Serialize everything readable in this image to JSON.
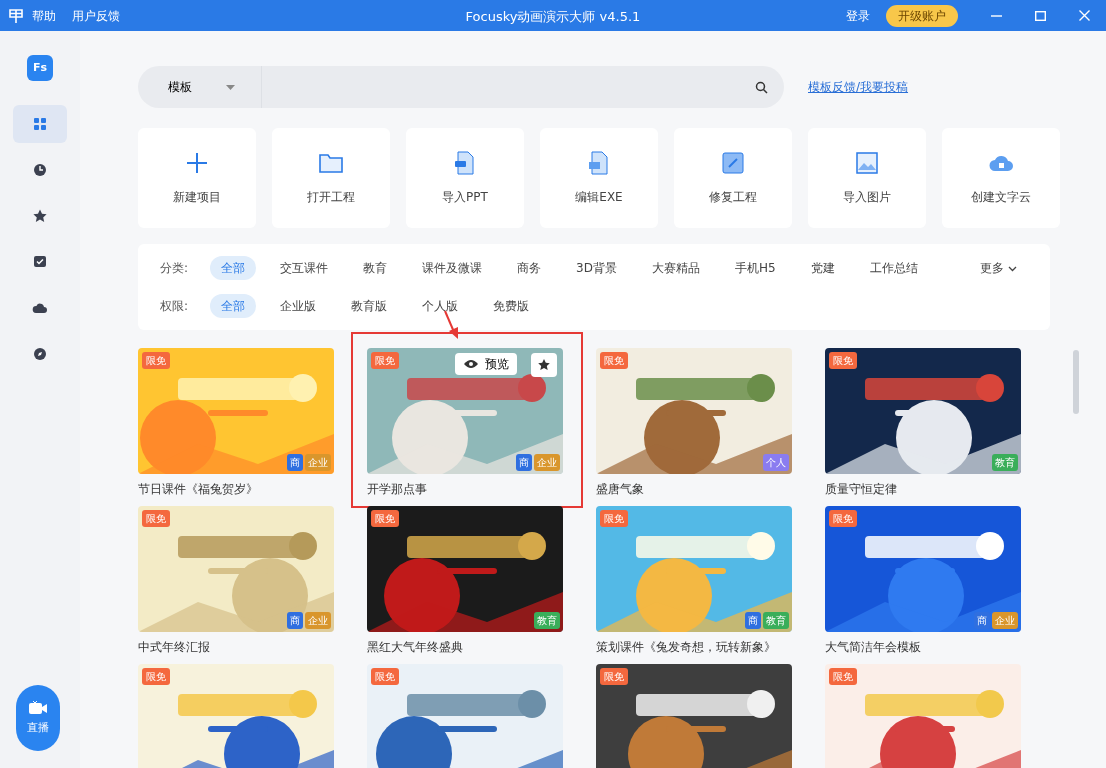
{
  "window": {
    "menu": [
      "帮助",
      "用户反馈"
    ],
    "title": "Focusky动画演示大师 v4.5.1",
    "login": "登录",
    "upgrade": "开级账户"
  },
  "sidebar": {
    "logo": "Fs",
    "items": [
      {
        "selected": true
      },
      {
        "selected": false
      },
      {
        "selected": false
      },
      {
        "selected": false
      },
      {
        "selected": false
      },
      {
        "selected": false
      }
    ],
    "live_button": "直播"
  },
  "search": {
    "category": "模板",
    "link": "模板反馈/我要投稿"
  },
  "tools": [
    {
      "label": "新建项目"
    },
    {
      "label": "打开工程"
    },
    {
      "label": "导入PPT"
    },
    {
      "label": "编辑EXE"
    },
    {
      "label": "修复工程"
    },
    {
      "label": "导入图片"
    },
    {
      "label": "创建文字云"
    }
  ],
  "filters": [
    {
      "label": "分类:",
      "options": [
        {
          "label": "全部",
          "selected": true
        },
        {
          "label": "交互课件",
          "selected": false
        },
        {
          "label": "教育",
          "selected": false
        },
        {
          "label": "课件及微课",
          "selected": false
        },
        {
          "label": "商务",
          "selected": false
        },
        {
          "label": "3D背景",
          "selected": false
        },
        {
          "label": "大赛精品",
          "selected": false
        },
        {
          "label": "手机H5",
          "selected": false
        },
        {
          "label": "党建",
          "selected": false
        },
        {
          "label": "工作总结",
          "selected": false
        }
      ],
      "more": "更多"
    },
    {
      "label": "权限:",
      "options": [
        {
          "label": "全部",
          "selected": true
        },
        {
          "label": "企业版",
          "selected": false
        },
        {
          "label": "教育版",
          "selected": false
        },
        {
          "label": "个人版",
          "selected": false
        },
        {
          "label": "免费版",
          "selected": false
        }
      ]
    }
  ],
  "templates": [
    {
      "free": "限免",
      "title": "节日课件《福兔贺岁》",
      "tags": [
        {
          "text": "商",
          "color": "#2f6fe0"
        },
        {
          "text": "企业",
          "color": "#d9962c"
        }
      ],
      "highlighted": false
    },
    {
      "free": "限免",
      "title": "开学那点事",
      "tags": [
        {
          "text": "商",
          "color": "#2f6fe0"
        },
        {
          "text": "企业",
          "color": "#d9962c"
        }
      ],
      "highlighted": true,
      "preview": "预览"
    },
    {
      "free": "限免",
      "title": "盛唐气象",
      "tags": [
        {
          "text": "个人",
          "color": "#8a7cf0"
        }
      ],
      "highlighted": false
    },
    {
      "free": "限免",
      "title": "质量守恒定律",
      "tags": [
        {
          "text": "教育",
          "color": "#3aae5a"
        }
      ],
      "highlighted": false
    },
    {
      "free": "限免",
      "title": "中式年终汇报",
      "tags": [
        {
          "text": "商",
          "color": "#2f6fe0"
        },
        {
          "text": "企业",
          "color": "#d9962c"
        }
      ],
      "highlighted": false
    },
    {
      "free": "限免",
      "title": "黑红大气年终盛典",
      "tags": [
        {
          "text": "教育",
          "color": "#3aae5a"
        }
      ],
      "highlighted": false
    },
    {
      "free": "限免",
      "title": "策划课件《兔发奇想，玩转新象》",
      "tags": [
        {
          "text": "商",
          "color": "#2f6fe0"
        },
        {
          "text": "教育",
          "color": "#3aae5a"
        }
      ],
      "highlighted": false
    },
    {
      "free": "限免",
      "title": "大气简洁年会模板",
      "tags": [
        {
          "text": "商",
          "color": "#2f6fe0"
        },
        {
          "text": "企业",
          "color": "#d9962c"
        }
      ],
      "highlighted": false
    },
    {
      "free": "限免",
      "highlighted": false
    },
    {
      "free": "限免",
      "highlighted": false
    },
    {
      "free": "限免",
      "highlighted": false
    },
    {
      "free": "限免",
      "highlighted": false
    }
  ]
}
